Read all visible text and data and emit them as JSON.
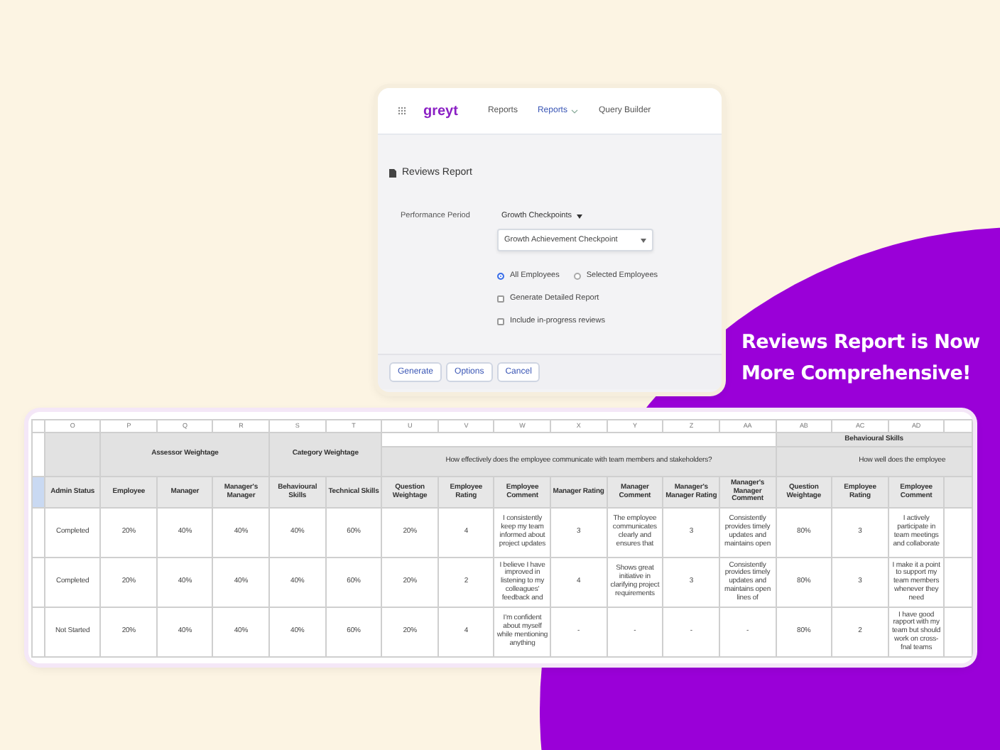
{
  "app": {
    "logo": "greyt",
    "nav": [
      {
        "label": "Reports",
        "selected": false
      },
      {
        "label": "Reports",
        "selected": true,
        "dropdown": true
      },
      {
        "label": "Query Builder",
        "selected": false
      }
    ]
  },
  "dialog": {
    "title": "Reviews Report",
    "field_label": "Performance Period",
    "period_type": "Growth Checkpoints",
    "period": "Growth Achievement Checkpoint",
    "radios": [
      {
        "label": "All Employees",
        "selected": true
      },
      {
        "label": "Selected Employees",
        "selected": false
      }
    ],
    "checkboxes": [
      {
        "label": "Generate Detailed Report",
        "checked": false
      },
      {
        "label": "Include in-progress reviews",
        "checked": false
      }
    ],
    "buttons": [
      "Generate",
      "Options",
      "Cancel"
    ]
  },
  "headline_lines": [
    "Reviews Report is Now",
    "More Comprehensive!"
  ],
  "sheet": {
    "column_letters": [
      "O",
      "P",
      "Q",
      "R",
      "S",
      "T",
      "U",
      "V",
      "W",
      "X",
      "Y",
      "Z",
      "AA",
      "AB",
      "AC",
      "AD"
    ],
    "groups": [
      {
        "label": "Assessor Weightage"
      },
      {
        "label": "Category Weightage"
      }
    ],
    "sections": [
      {
        "question": "How effectively does the employee communicate with team members and stakeholders?"
      },
      {
        "label": "Behavioural Skills",
        "question": "How well does the employee"
      }
    ],
    "columns": [
      "Admin Status",
      "Employee",
      "Manager",
      "Manager's Manager",
      "Behavioural Skills",
      "Technical Skills",
      "Question Weightage",
      "Employee Rating",
      "Employee Comment",
      "Manager Rating",
      "Manager Comment",
      "Manager's Manager Rating",
      "Manager's Manager Comment",
      "Question Weightage",
      "Employee Rating",
      "Employee Comment"
    ],
    "rows": [
      [
        "Completed",
        "20%",
        "40%",
        "40%",
        "40%",
        "60%",
        "20%",
        "4",
        "I consistently keep my team informed about project updates",
        "3",
        "The employee communicates clearly and ensures that",
        "3",
        "Consistently provides timely updates and maintains open",
        "80%",
        "3",
        "I actively participate in team meetings and collaborate"
      ],
      [
        "Completed",
        "20%",
        "40%",
        "40%",
        "40%",
        "60%",
        "20%",
        "2",
        "I believe I have improved in listening to my colleagues' feedback and",
        "4",
        "Shows great initiative in clarifying project requirements",
        "3",
        "Consistently provides timely updates and maintains open lines of",
        "80%",
        "3",
        "I make it a point to support my team members whenever they need"
      ],
      [
        "Not Started",
        "20%",
        "40%",
        "40%",
        "40%",
        "60%",
        "20%",
        "4",
        "I'm confident about myself while mentioning anything",
        "-",
        "-",
        "-",
        "-",
        "80%",
        "2",
        "I have good rapport with my team but should work on cross-fnal teams"
      ]
    ]
  }
}
